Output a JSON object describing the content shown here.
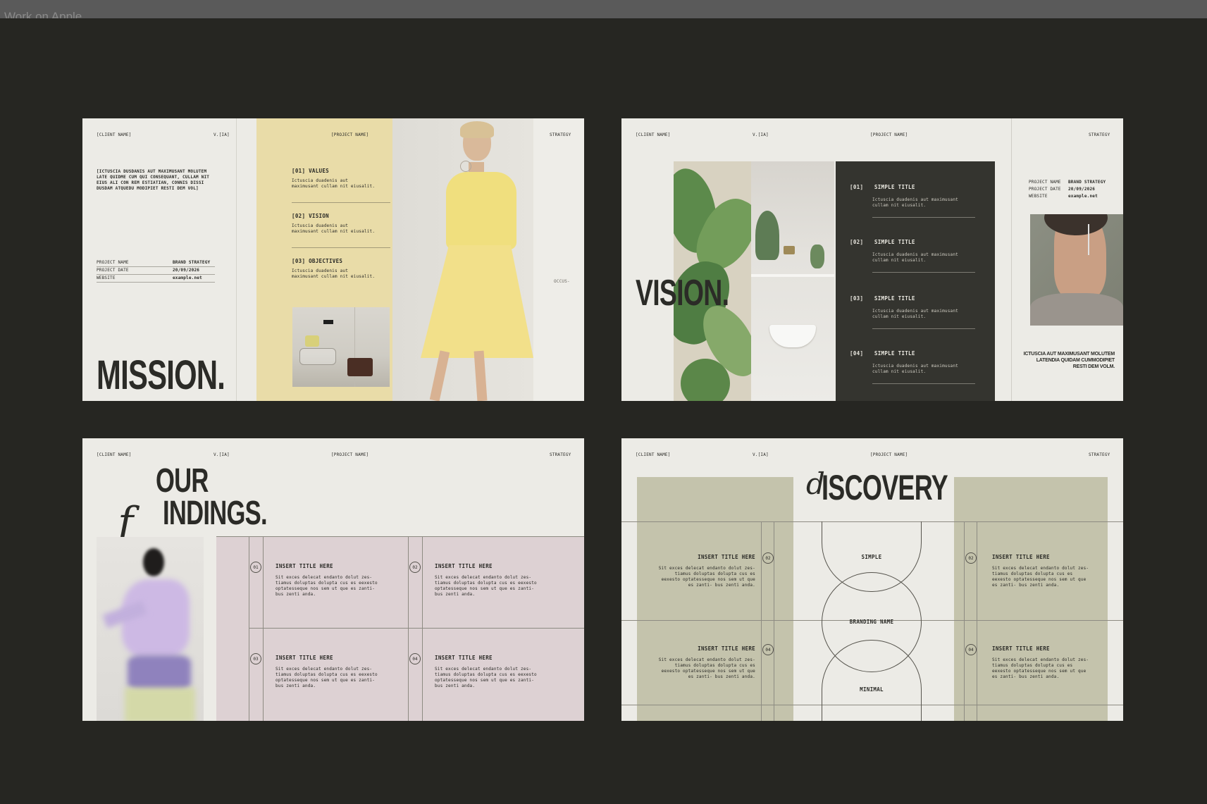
{
  "window": {
    "title": "Work on Apple"
  },
  "slides": {
    "mission": {
      "client": "[CLIENT NAME]",
      "version": "V.[IA]",
      "project": "[PROJECT NAME]",
      "section": "STRATEGY",
      "intro": "[ICTUSCIA DUSDANIS AUT MAXIMUSANT MOLUTEM LATE QUIDME CUM QUI CONSEQUANT, CULLAM NIT EIUS ALI CON REM ESTIATIAN, CONNIS DISSI DUSDAM ATQUEDU MODIPIET RESTI DEM VOL]",
      "meta": [
        {
          "k": "PROJECT NAME",
          "v": "BRAND STRATEGY"
        },
        {
          "k": "PROJECT DATE",
          "v": "20/09/2026"
        },
        {
          "k": "WEBSITE",
          "v": "example.net"
        }
      ],
      "items": [
        {
          "label": "[01] VALUES",
          "body": "Ictuscia duadenis aut maximusant cullam nit eiusalit."
        },
        {
          "label": "[02] VISION",
          "body": "Ictuscia duadenis aut maximusant cullam nit eiusalit."
        },
        {
          "label": "[03] OBJECTIVES",
          "body": "Ictuscia duadenis aut maximusant cullam nit eiusalit."
        }
      ],
      "side_note": "OCCUS-",
      "title": "MISSION."
    },
    "vision": {
      "client": "[CLIENT NAME]",
      "version": "V.[IA]",
      "project": "[PROJECT NAME]",
      "section": "STRATEGY",
      "title": "VISION.",
      "items": [
        {
          "num": "[01]",
          "label": "SIMPLE TITLE",
          "body": "Ictuscia duadenis aut maximusant cullam nit eiusalit."
        },
        {
          "num": "[02]",
          "label": "SIMPLE TITLE",
          "body": "Ictuscia duadenis aut maximusant cullam nit eiusalit."
        },
        {
          "num": "[03]",
          "label": "SIMPLE TITLE",
          "body": "Ictuscia duadenis aut maximusant cullam nit eiusalit."
        },
        {
          "num": "[04]",
          "label": "SIMPLE TITLE",
          "body": "Ictuscia duadenis aut maximusant cullam nit eiusalit."
        }
      ],
      "meta": [
        {
          "k": "PROJECT NAME",
          "v": "BRAND STRATEGY"
        },
        {
          "k": "PROJECT DATE",
          "v": "20/09/2026"
        },
        {
          "k": "WEBSITE",
          "v": "example.net"
        }
      ],
      "caption": "ICTUSCIA AUT MAXIMUSANT MOLUTEM LATENDIA QUIDAM CUMMODIPIET RESTI DEM VOLM."
    },
    "findings": {
      "client": "[CLIENT NAME]",
      "version": "V.[IA]",
      "project": "[PROJECT NAME]",
      "section": "STRATEGY",
      "title_line1": "OUR",
      "title_line2": "INDINGS.",
      "script_letter": "f",
      "items": [
        {
          "num": "01",
          "label": "INSERT TITLE HERE",
          "body": "Sit exces delecat endanto dolut zes- tiamus doluptas dolupta cus es eexesto optatessequе nos sem ut que es zanti- bus zenti anda."
        },
        {
          "num": "02",
          "label": "INSERT TITLE HERE",
          "body": "Sit exces delecat endanto dolut zes- tiamus doluptas dolupta cus es eexesto optatessequе nos sem ut que es zanti- bus zenti anda."
        },
        {
          "num": "03",
          "label": "INSERT TITLE HERE",
          "body": "Sit exces delecat endanto dolut zes- tiamus doluptas dolupta cus es eexesto optatessequе nos sem ut que es zanti- bus zenti anda."
        },
        {
          "num": "04",
          "label": "INSERT TITLE HERE",
          "body": "Sit exces delecat endanto dolut zes- tiamus doluptas dolupta cus es eexesto optatessequе nos sem ut que es zanti- bus zenti anda."
        }
      ]
    },
    "discovery": {
      "client": "[CLIENT NAME]",
      "version": "V.[IA]",
      "project": "[PROJECT NAME]",
      "section": "STRATEGY",
      "script_letter": "d",
      "title": "ISCOVERY",
      "center_top": "SIMPLE",
      "center_mid": "BRANDING NAME",
      "center_bottom": "MINIMAL",
      "items": [
        {
          "num": "02",
          "label": "INSERT TITLE HERE",
          "body": "Sit exces delecat endanto dolut zes- tiamus doluptas dolupta cus es eexesto optatessequе nos sem ut que es zanti- bus zenti anda."
        },
        {
          "num": "04",
          "label": "INSERT TITLE HERE",
          "body": "Sit exces delecat endanto dolut zes- tiamus doluptas dolupta cus es eexesto optatessequе nos sem ut que es zanti- bus zenti anda."
        },
        {
          "num": "02",
          "label": "INSERT TITLE HERE",
          "body": "Sit exces delecat endanto dolut zes- tiamus doluptas dolupta cus es eexesto optatessequе nos sem ut que es zanti- bus zenti anda."
        },
        {
          "num": "04",
          "label": "INSERT TITLE HERE",
          "body": "Sit exces delecat endanto dolut zes- tiamus doluptas dolupta cus es eexesto optatessequе nos sem ut que es zanti- bus zenti anda."
        }
      ]
    }
  }
}
